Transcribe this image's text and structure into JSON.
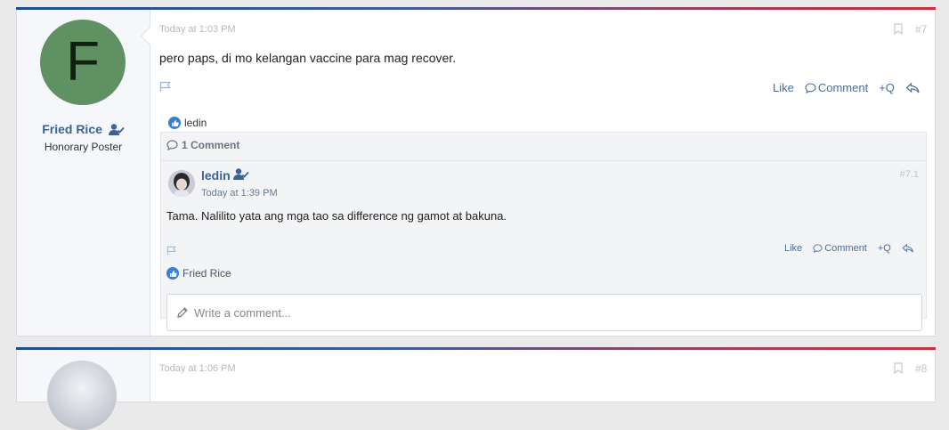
{
  "post1": {
    "avatar_letter": "F",
    "author": {
      "name": "Fried Rice",
      "title": "Honorary Poster"
    },
    "time": "Today at 1:03 PM",
    "number": "#7",
    "message": "pero paps, di mo kelangan vaccine para mag recover.",
    "actions": {
      "like": "Like",
      "comment": "Comment",
      "quote": "+Q"
    },
    "reactions": {
      "names": "ledin"
    },
    "comments": {
      "count_label": "1 Comment",
      "items": [
        {
          "author": "ledin",
          "time": "Today at 1:39 PM",
          "number": "#7.1",
          "text": "Tama. Nalilito yata ang mga tao sa difference ng gamot at bakuna.",
          "actions": {
            "like": "Like",
            "comment": "Comment",
            "quote": "+Q"
          },
          "reactions": "Fried Rice"
        }
      ],
      "input_placeholder": "Write a comment..."
    }
  },
  "post2": {
    "time": "Today at 1:06 PM",
    "number": "#8"
  },
  "colors": {
    "accent_link": "#3b6396",
    "avatar_bg": "#5f9162",
    "like_blue": "#3a80d0"
  },
  "icons": [
    "user-check-icon",
    "bookmark-icon",
    "flag-icon",
    "comment-icon",
    "reply-icon",
    "thumbs-up-icon",
    "pencil-icon"
  ]
}
